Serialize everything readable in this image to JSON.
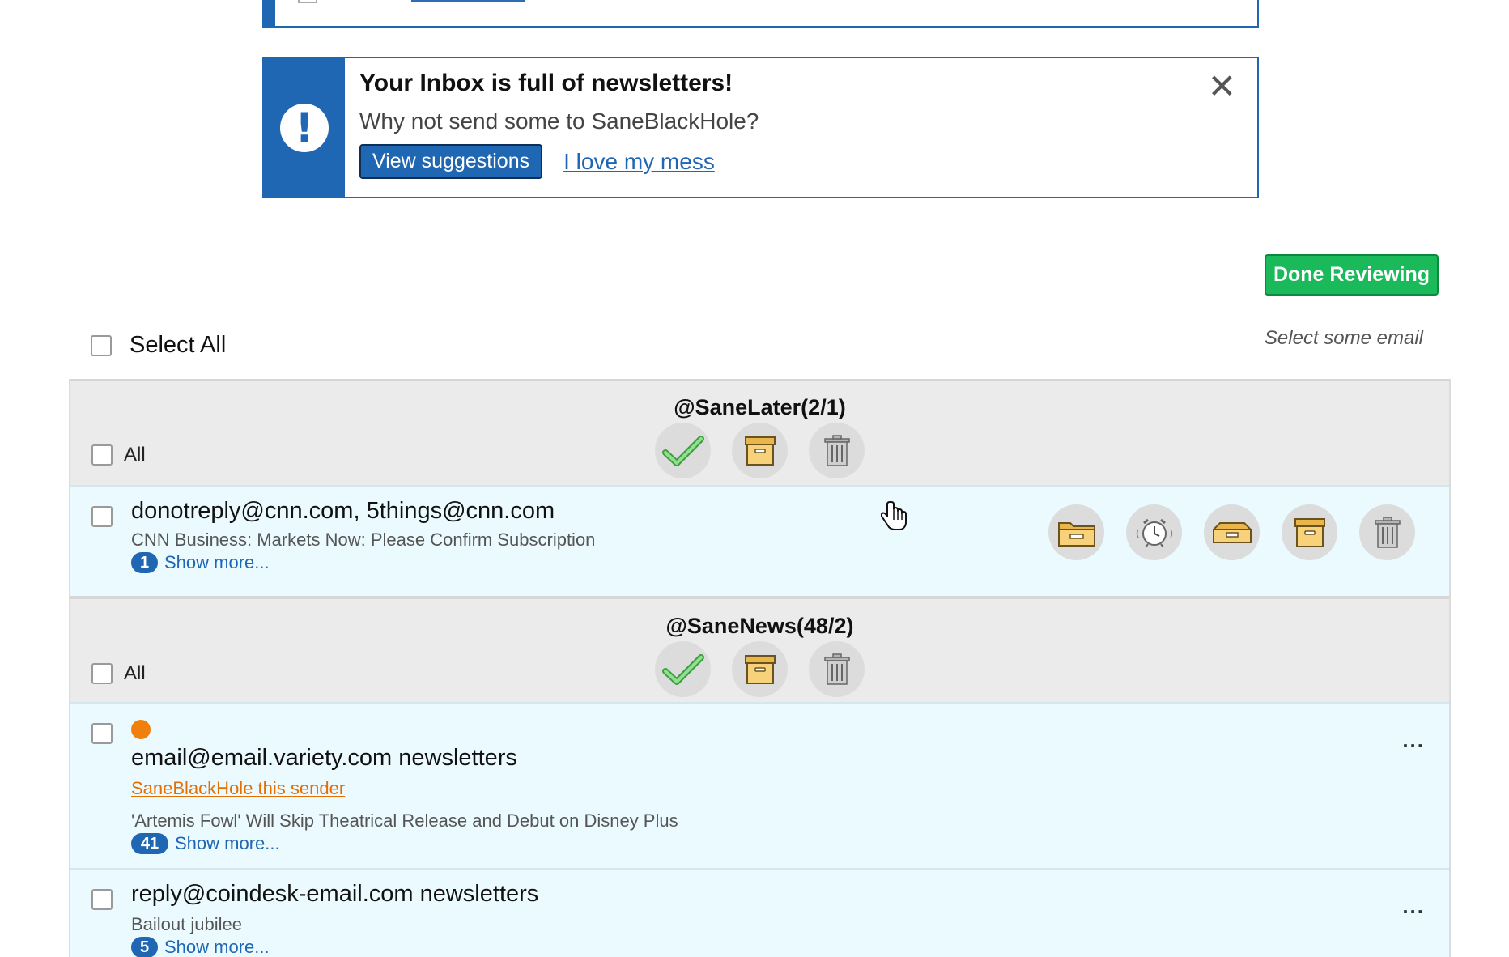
{
  "banner": {
    "title": "Your Inbox is full of newsletters!",
    "subtitle": "Why not send some to SaneBlackHole?",
    "primary_label": "View suggestions",
    "secondary_label": "I love my mess",
    "alert_glyph": "!",
    "close_glyph": "✕"
  },
  "toolbar": {
    "done_label": "Done Reviewing",
    "select_all_label": "Select All",
    "select_hint": "Select some email"
  },
  "groups": [
    {
      "title": "@SaneLater(2/1)",
      "all_label": "All",
      "emails": [
        {
          "sender": "donotreply@cnn.com, 5things@cnn.com",
          "subject": "CNN Business: Markets Now: Please Confirm Subscription",
          "count": "1",
          "show_more": "Show more..."
        }
      ]
    },
    {
      "title": "@SaneNews(48/2)",
      "all_label": "All",
      "emails": [
        {
          "sender": "email@email.variety.com newsletters",
          "blackhole_label": "SaneBlackHole this sender",
          "subject": "'Artemis Fowl' Will Skip Theatrical Release and Debut on Disney Plus",
          "count": "41",
          "show_more": "Show more...",
          "more_glyph": "..."
        },
        {
          "sender": "reply@coindesk-email.com newsletters",
          "subject": "Bailout jubilee",
          "count": "5",
          "show_more": "Show more...",
          "more_glyph": "..."
        }
      ]
    }
  ],
  "colors": {
    "brand_blue": "#1f66b3",
    "done_green": "#1aba5b",
    "row_bg": "#eafaff",
    "group_bg": "#ebebeb",
    "blackhole_orange": "#e56e00"
  },
  "icons": [
    "check-icon",
    "archive-box-icon",
    "trash-icon",
    "folder-icon",
    "alarm-clock-icon",
    "inbox-tray-icon",
    "close-icon",
    "alert-icon",
    "more-icon",
    "hand-cursor-icon"
  ]
}
